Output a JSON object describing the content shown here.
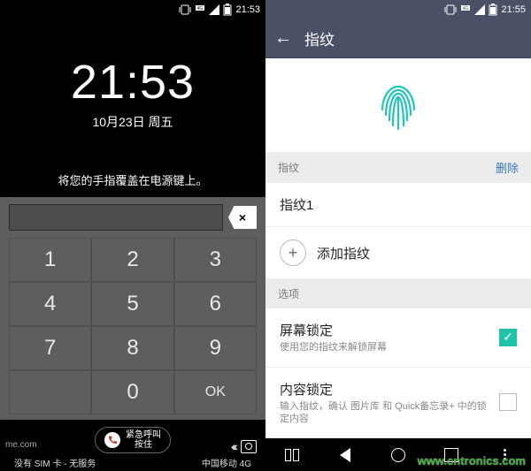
{
  "left": {
    "status": {
      "time": "21:53"
    },
    "clock": {
      "time": "21:53",
      "date": "10月23日 周五"
    },
    "hint": "将您的手指覆盖在电源键上。",
    "keys": {
      "k1": "1",
      "k2": "2",
      "k3": "3",
      "k4": "4",
      "k5": "5",
      "k6": "6",
      "k7": "7",
      "k8": "8",
      "k9": "9",
      "k0": "0",
      "ok": "OK",
      "bs": "×"
    },
    "emergency": {
      "domain": "me.com",
      "line1": "紧急呼叫",
      "line2": "按住"
    },
    "sim": {
      "left": "没有 SIM 卡 - 无服务",
      "right": "中国移动 4G"
    }
  },
  "right": {
    "status": {
      "time": "21:55"
    },
    "header": {
      "title": "指纹"
    },
    "section_fp": {
      "label": "指纹",
      "delete": "删除"
    },
    "fp1": "指纹1",
    "add_fp": "添加指纹",
    "section_opt": "选项",
    "screen_lock": {
      "title": "屏幕锁定",
      "sub": "使用您的指纹来解锁屏幕"
    },
    "content_lock": {
      "title": "内容锁定",
      "sub": "输入指纹，确认 图片库 和 Quick备忘录+ 中的锁定内容"
    }
  },
  "watermark": "www.cntronics.com"
}
